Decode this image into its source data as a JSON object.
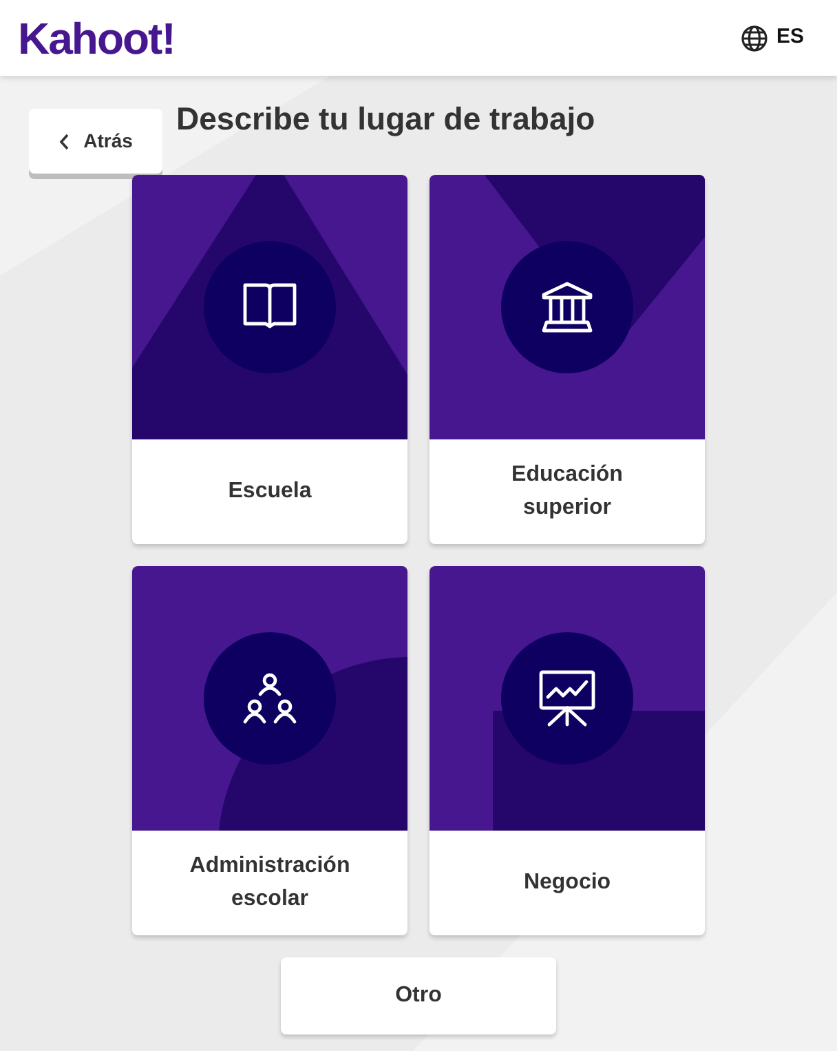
{
  "header": {
    "logo": "Kahoot!",
    "language": "ES"
  },
  "back_button": {
    "label": "Atrás"
  },
  "title": "Describe tu lugar de trabajo",
  "options": [
    {
      "kind": "school",
      "label": "Escuela"
    },
    {
      "kind": "higher_education",
      "label": "Educación superior"
    },
    {
      "kind": "school_admin",
      "label": "Administración escolar"
    },
    {
      "kind": "business",
      "label": "Negocio"
    }
  ],
  "other_button": {
    "label": "Otro"
  }
}
